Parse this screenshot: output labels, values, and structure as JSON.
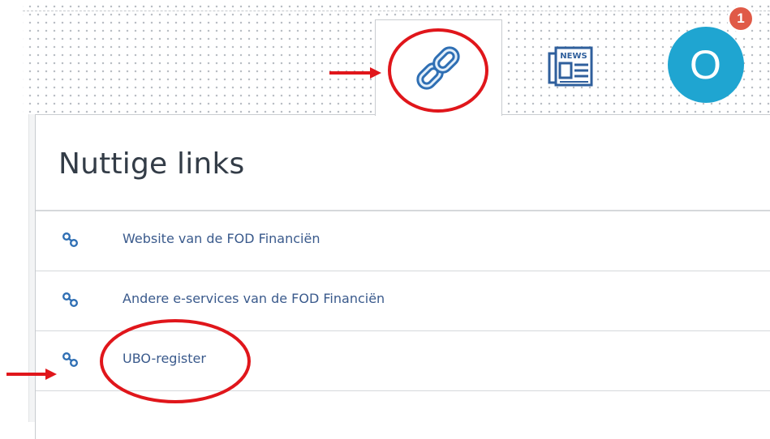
{
  "toolbar": {
    "links_icon": "link-chain-icon",
    "news_icon": "news-icon",
    "news_label": "NEWS",
    "avatar_initial": "O",
    "notification_count": "1"
  },
  "panel": {
    "title": "Nuttige links",
    "links": [
      {
        "label": "Website van de FOD Financiën",
        "icon": "link-icon"
      },
      {
        "label": "Andere e-services van de FOD Financiën",
        "icon": "link-icon"
      },
      {
        "label": "UBO-register",
        "icon": "link-icon"
      }
    ]
  },
  "colors": {
    "accent": "#1fa5d1",
    "link_text": "#3a5a8c",
    "badge": "#e05a47",
    "annotation": "#e0161b"
  }
}
